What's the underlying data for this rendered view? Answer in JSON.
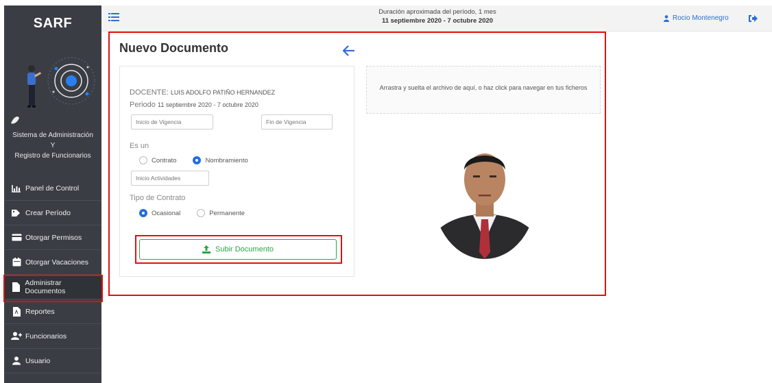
{
  "sidebar": {
    "brand": "SARF",
    "system_name_lines": [
      "Sistema de Administración",
      "Y",
      "Registro de Funcionarios"
    ],
    "items": [
      {
        "label": "Panel de Control",
        "icon": "chart-icon"
      },
      {
        "label": "Crear Período",
        "icon": "tag-icon"
      },
      {
        "label": "Otorgar Permisos",
        "icon": "card-icon"
      },
      {
        "label": "Otorgar Vacaciones",
        "icon": "calendar-icon"
      },
      {
        "label": "Administrar Documentos",
        "icon": "file-icon",
        "active": true
      },
      {
        "label": "Reportes",
        "icon": "pdf-icon"
      },
      {
        "label": "Funcionarios",
        "icon": "users-icon"
      },
      {
        "label": "Usuario",
        "icon": "user-icon"
      }
    ]
  },
  "topbar": {
    "period_text": "Duración aproximada del período, 1 mes",
    "period_dates": "11 septiembre 2020 - 7 octubre 2020",
    "user_name": "Rocio Montenegro"
  },
  "main": {
    "title": "Nuevo Documento",
    "form": {
      "docente_label": "DOCENTE:",
      "docente_name": "LUIS ADOLFO PATIÑO HERNANDEZ",
      "periodo_label": "Periodo",
      "periodo_value": "11 septiembre 2020 - 7 octubre 2020",
      "inicio_vigencia_placeholder": "Inicio de Vigencia",
      "fin_vigencia_placeholder": "Fin de Vigencia",
      "es_un_label": "Es un",
      "tipo_options": [
        "Contrato",
        "Nombramiento"
      ],
      "inicio_actividades_placeholder": "Inicio Actividades",
      "tipo_contrato_label": "Tipo de Contrato",
      "contrato_options": [
        "Ocasional",
        "Permanente"
      ],
      "upload_label": "Subir Documento"
    },
    "dropzone_text": "Arrastra y suelta el archivo de aquí, o haz click para navegar en tus ficheros"
  },
  "colors": {
    "sidebar_bg": "#3a3e44",
    "accent_blue": "#1f6fe0",
    "upload_green": "#28a745",
    "highlight_red": "#e01010"
  }
}
